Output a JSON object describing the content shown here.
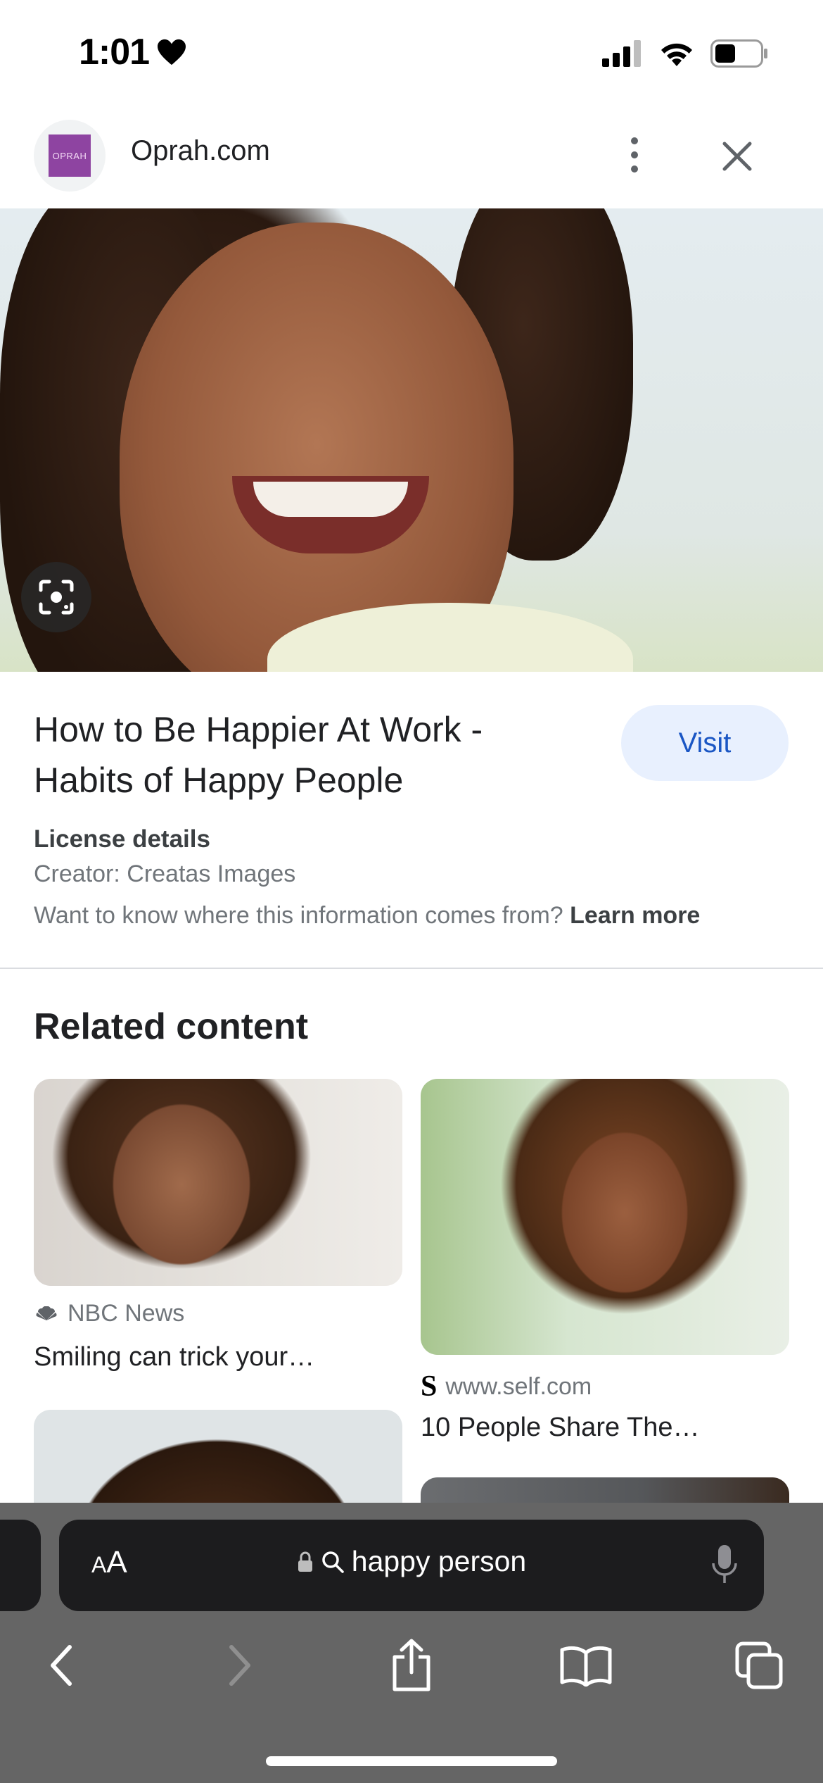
{
  "status_bar": {
    "time": "1:01",
    "icons": [
      "heart-icon",
      "cellular-signal-icon",
      "wifi-icon",
      "battery-icon"
    ]
  },
  "header": {
    "logo_text": "OPRAH",
    "site_name": "Oprah.com",
    "logo_color": "#8e44a1"
  },
  "result": {
    "title": "How to Be Happier At Work - Habits of Happy People",
    "visit_label": "Visit",
    "license_title": "License details",
    "creator": "Creator: Creatas Images",
    "info_text": "Want to know where this information comes from?",
    "learn_more": "Learn more"
  },
  "related": {
    "heading": "Related content",
    "items": [
      {
        "source": "NBC News",
        "title": "Smiling can trick your…"
      },
      {
        "source": "www.self.com",
        "title": "10 People Share The…"
      }
    ]
  },
  "address_bar": {
    "aa_label_small": "A",
    "aa_label_large": "A",
    "query": "happy person"
  },
  "colors": {
    "accent": "#1a56c4",
    "visit_bg": "#e8f0fe",
    "toolbar_bg": "#656565"
  }
}
